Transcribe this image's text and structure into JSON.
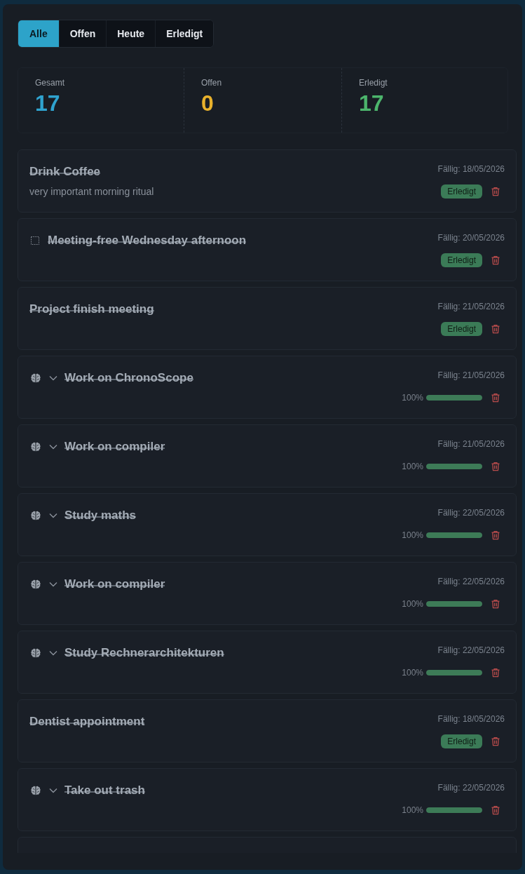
{
  "tabs": [
    {
      "label": "Alle",
      "selected": true
    },
    {
      "label": "Offen",
      "selected": false
    },
    {
      "label": "Heute",
      "selected": false
    },
    {
      "label": "Erledigt",
      "selected": false
    }
  ],
  "stats": [
    {
      "label": "Gesamt",
      "value": "17",
      "color": "#2fa3cf"
    },
    {
      "label": "Offen",
      "value": "0",
      "color": "#e8b12c"
    },
    {
      "label": "Erledigt",
      "value": "17",
      "color": "#4cb56c"
    }
  ],
  "list": {
    "cut_off": true,
    "items": [
      {
        "kind": "task",
        "title": "Drink Coffee",
        "description": "very important morning ritual",
        "done": true,
        "due": "Fällig: 18/05/2026",
        "status": "Erledigt"
      },
      {
        "kind": "marked",
        "title": "Meeting-free Wednesday afternoon",
        "done": true,
        "due": "Fällig: 20/05/2026",
        "status": "Erledigt"
      },
      {
        "kind": "task",
        "title": "Project finish meeting",
        "done": true,
        "due": "Fällig: 21/05/2026",
        "status": "Erledigt"
      },
      {
        "kind": "project",
        "title": "Work on ChronoScope",
        "done": true,
        "expanded": false,
        "due": "Fällig: 21/05/2026",
        "progress": "100%",
        "level": 1
      },
      {
        "kind": "project",
        "title": "Work on compiler",
        "done": true,
        "expanded": false,
        "due": "Fällig: 21/05/2026",
        "progress": "100%",
        "level": 1
      },
      {
        "kind": "project",
        "title": "Study maths",
        "done": true,
        "expanded": false,
        "due": "Fällig: 22/05/2026",
        "progress": "100%",
        "level": 1
      },
      {
        "kind": "project",
        "title": "Work on compiler",
        "done": true,
        "expanded": false,
        "due": "Fällig: 22/05/2026",
        "progress": "100%",
        "level": 1
      },
      {
        "kind": "project",
        "title": "Study Rechnerarchitekturen",
        "done": true,
        "expanded": false,
        "due": "Fällig: 22/05/2026",
        "progress": "100%",
        "level": 1
      },
      {
        "kind": "task",
        "title": "Dentist appointment",
        "done": true,
        "due": "Fällig: 18/05/2026",
        "status": "Erledigt"
      },
      {
        "kind": "project",
        "title": "Take out trash",
        "done": true,
        "expanded": false,
        "due": "Fällig: 22/05/2026",
        "progress": "100%",
        "level": 1
      }
    ]
  }
}
